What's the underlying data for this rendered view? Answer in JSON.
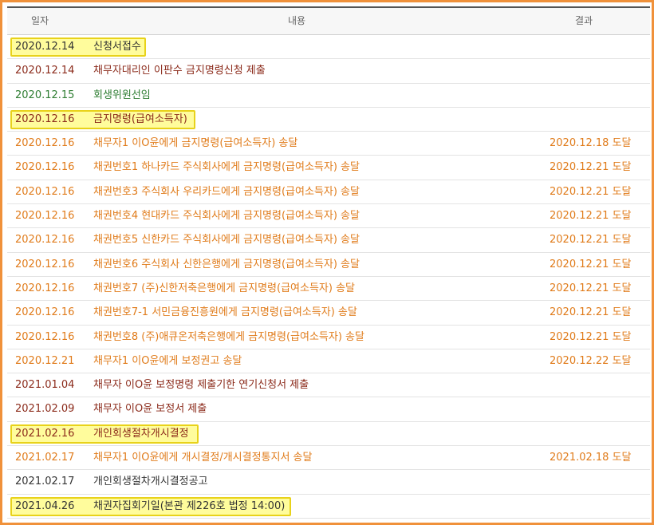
{
  "table": {
    "headers": {
      "date": "일자",
      "content": "내용",
      "result": "결과"
    },
    "rows": [
      {
        "date": "2020.12.14",
        "content": "신청서접수",
        "result": "",
        "color": "#333333",
        "highlight": true,
        "hl_width": 170
      },
      {
        "date": "2020.12.14",
        "content": "채무자대리인 이판수 금지명령신청 제출",
        "result": "",
        "color": "#8b2a1a",
        "highlight": false
      },
      {
        "date": "2020.12.15",
        "content": "회생위원선임",
        "result": "",
        "color": "#2e7d32",
        "highlight": false
      },
      {
        "date": "2020.12.16",
        "content": "금지명령(급여소득자)",
        "result": "",
        "color": "#8b2a1a",
        "highlight": true,
        "hl_width": 232
      },
      {
        "date": "2020.12.16",
        "content": "채무자1 이O윤에게 금지명령(급여소득자) 송달",
        "result": "2020.12.18 도달",
        "color": "#e07b1a",
        "highlight": false
      },
      {
        "date": "2020.12.16",
        "content": "채권번호1 하나카드 주식회사에게 금지명령(급여소득자) 송달",
        "result": "2020.12.21 도달",
        "color": "#e07b1a",
        "highlight": false
      },
      {
        "date": "2020.12.16",
        "content": "채권번호3 주식회사 우리카드에게 금지명령(급여소득자) 송달",
        "result": "2020.12.21 도달",
        "color": "#e07b1a",
        "highlight": false
      },
      {
        "date": "2020.12.16",
        "content": "채권번호4 현대카드 주식회사에게 금지명령(급여소득자) 송달",
        "result": "2020.12.21 도달",
        "color": "#e07b1a",
        "highlight": false
      },
      {
        "date": "2020.12.16",
        "content": "채권번호5 신한카드 주식회사에게 금지명령(급여소득자) 송달",
        "result": "2020.12.21 도달",
        "color": "#e07b1a",
        "highlight": false
      },
      {
        "date": "2020.12.16",
        "content": "채권번호6 주식회사 신한은행에게 금지명령(급여소득자) 송달",
        "result": "2020.12.21 도달",
        "color": "#e07b1a",
        "highlight": false
      },
      {
        "date": "2020.12.16",
        "content": "채권번호7 (주)신한저축은행에게 금지명령(급여소득자) 송달",
        "result": "2020.12.21 도달",
        "color": "#e07b1a",
        "highlight": false
      },
      {
        "date": "2020.12.16",
        "content": "채권번호7-1 서민금융진흥원에게 금지명령(급여소득자) 송달",
        "result": "2020.12.21 도달",
        "color": "#e07b1a",
        "highlight": false
      },
      {
        "date": "2020.12.16",
        "content": "채권번호8 (주)애큐온저축은행에게 금지명령(급여소득자) 송달",
        "result": "2020.12.21 도달",
        "color": "#e07b1a",
        "highlight": false
      },
      {
        "date": "2020.12.21",
        "content": "채무자1 이O윤에게 보정권고 송달",
        "result": "2020.12.22 도달",
        "color": "#e07b1a",
        "highlight": false
      },
      {
        "date": "2021.01.04",
        "content": "채무자 이O윤 보정명령 제출기한 연기신청서 제출",
        "result": "",
        "color": "#8b2a1a",
        "highlight": false
      },
      {
        "date": "2021.02.09",
        "content": "채무자 이O윤 보정서 제출",
        "result": "",
        "color": "#8b2a1a",
        "highlight": false
      },
      {
        "date": "2021.02.16",
        "content": "개인회생절차개시결정",
        "result": "",
        "color": "#8b2a1a",
        "highlight": true,
        "hl_width": 236
      },
      {
        "date": "2021.02.17",
        "content": "채무자1 이O윤에게 개시결정/개시결정통지서 송달",
        "result": "2021.02.18 도달",
        "color": "#e07b1a",
        "highlight": false
      },
      {
        "date": "2021.02.17",
        "content": "개인회생절차개시결정공고",
        "result": "",
        "color": "#333333",
        "highlight": false
      },
      {
        "date": "2021.04.26",
        "content": "채권자집회기일(본관 제226호 법정 14:00)",
        "result": "",
        "color": "#333333",
        "highlight": true,
        "hl_width": 352
      }
    ]
  }
}
